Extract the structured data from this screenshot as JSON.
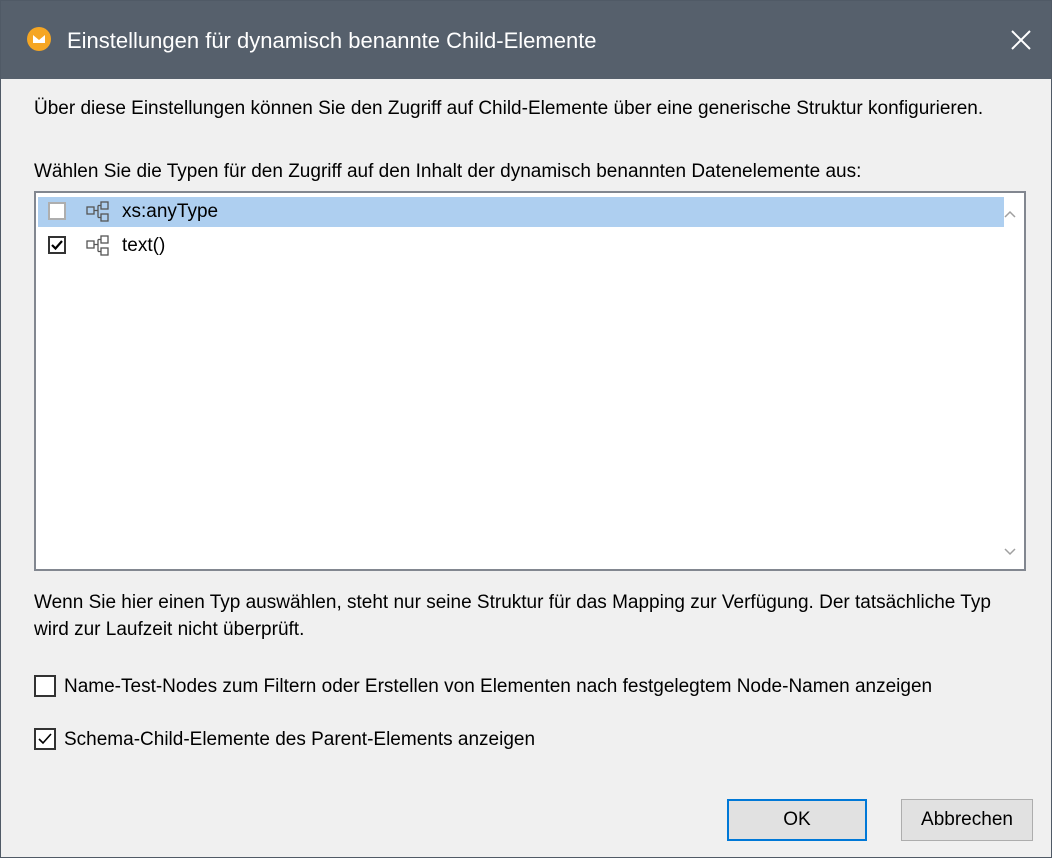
{
  "dialog": {
    "title": "Einstellungen für dynamisch benannte Child-Elemente",
    "intro": "Über diese Einstellungen können Sie den Zugriff auf Child-Elemente über eine generische Struktur konfigurieren.",
    "choose_label": "Wählen Sie die Typen für den Zugriff auf den Inhalt der dynamisch benannten Datenelemente aus:",
    "types": [
      {
        "label": "xs:anyType",
        "checked": false,
        "selected": true
      },
      {
        "label": "text()",
        "checked": true,
        "selected": false
      }
    ],
    "note": "Wenn Sie hier einen Typ auswählen, steht nur seine Struktur für das Mapping zur Verfügung. Der tatsächliche Typ wird zur Laufzeit nicht überprüft.",
    "options": [
      {
        "label": "Name-Test-Nodes zum Filtern oder Erstellen von Elementen nach festgelegtem Node-Namen anzeigen",
        "checked": false
      },
      {
        "label": "Schema-Child-Elemente des Parent-Elements anzeigen",
        "checked": true
      }
    ],
    "buttons": {
      "ok": "OK",
      "cancel": "Abbrechen"
    }
  },
  "colors": {
    "titlebar": "#56606c",
    "selection": "#aecff0",
    "accent": "#0078d7",
    "app_icon": "#f5a623"
  },
  "icons": [
    "app-icon",
    "close-icon",
    "element-tree-icon",
    "checkmark-icon",
    "scroll-up-icon",
    "scroll-down-icon"
  ]
}
